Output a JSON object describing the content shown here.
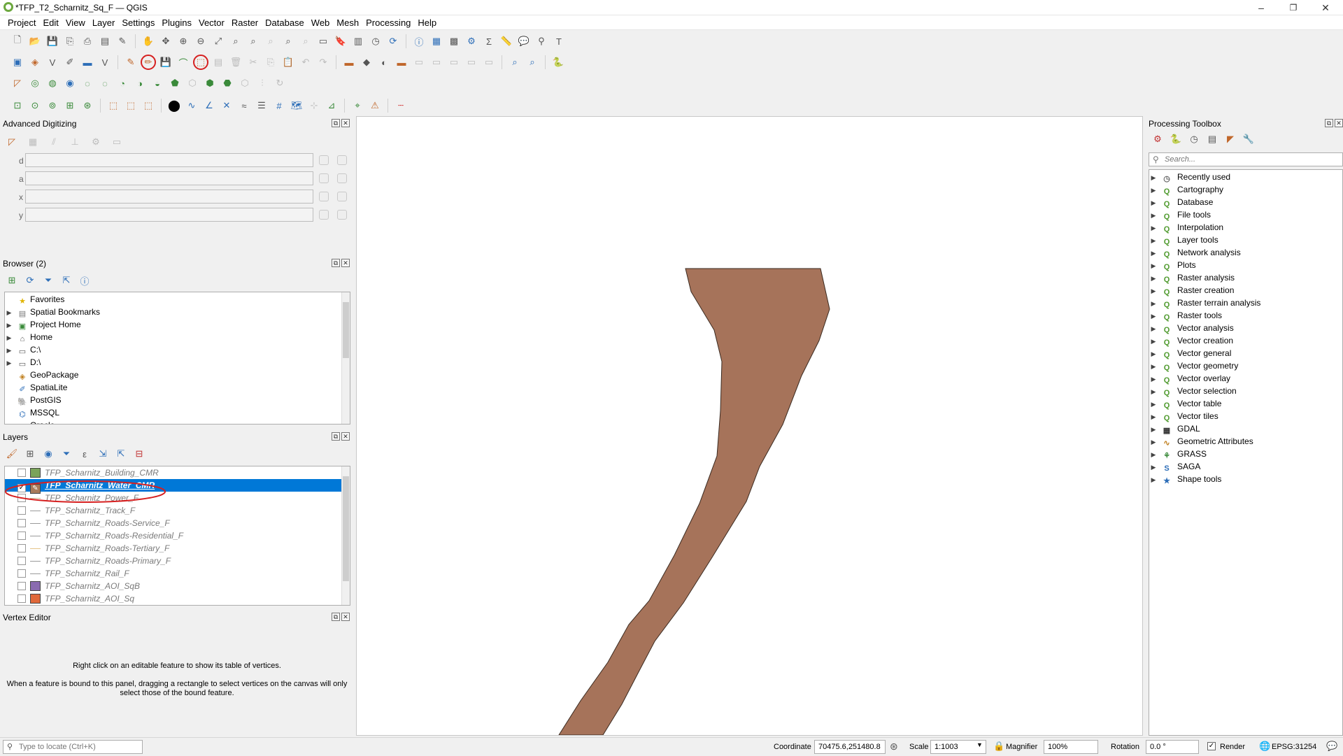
{
  "window": {
    "title": "*TFP_T2_Scharnitz_Sq_F — QGIS",
    "minimize": "–",
    "maximize": "❐",
    "close": "✕"
  },
  "menu": [
    "Project",
    "Edit",
    "View",
    "Layer",
    "Settings",
    "Plugins",
    "Vector",
    "Raster",
    "Database",
    "Web",
    "Mesh",
    "Processing",
    "Help"
  ],
  "advanced_digitizing": {
    "title": "Advanced Digitizing",
    "fields": [
      {
        "label": "d",
        "value": ""
      },
      {
        "label": "a",
        "value": ""
      },
      {
        "label": "x",
        "value": ""
      },
      {
        "label": "y",
        "value": ""
      }
    ]
  },
  "browser": {
    "title": "Browser (2)",
    "items": [
      {
        "label": "Favorites",
        "icon": "star-icon",
        "expandable": false
      },
      {
        "label": "Spatial Bookmarks",
        "icon": "bookmark-icon",
        "expandable": true
      },
      {
        "label": "Project Home",
        "icon": "project-home-icon",
        "expandable": true
      },
      {
        "label": "Home",
        "icon": "home-folder-icon",
        "expandable": true
      },
      {
        "label": "C:\\",
        "icon": "folder-icon",
        "expandable": true
      },
      {
        "label": "D:\\",
        "icon": "folder-icon",
        "expandable": true
      },
      {
        "label": "GeoPackage",
        "icon": "geopackage-icon",
        "expandable": false
      },
      {
        "label": "SpatiaLite",
        "icon": "spatialite-icon",
        "expandable": false
      },
      {
        "label": "PostGIS",
        "icon": "postgis-icon",
        "expandable": false
      },
      {
        "label": "MSSQL",
        "icon": "mssql-icon",
        "expandable": false
      },
      {
        "label": "Oracle",
        "icon": "oracle-icon",
        "expandable": false
      }
    ]
  },
  "layers": {
    "title": "Layers",
    "items": [
      {
        "name": "TFP_Scharnitz_Building_CMR",
        "checked": false,
        "selected": false,
        "symbol": "fill",
        "color": "#7aa35a"
      },
      {
        "name": "TFP_Scharnitz_Water_CMR",
        "checked": true,
        "selected": true,
        "symbol": "fill",
        "color": "#a87a5a"
      },
      {
        "name": "TFP_Scharnitz_Power_F",
        "checked": false,
        "selected": false,
        "symbol": "line",
        "color": "#c9b98f"
      },
      {
        "name": "TFP_Scharnitz_Track_F",
        "checked": false,
        "selected": false,
        "symbol": "line",
        "color": "#9a9a9a"
      },
      {
        "name": "TFP_Scharnitz_Roads-Service_F",
        "checked": false,
        "selected": false,
        "symbol": "line",
        "color": "#9a9a9a"
      },
      {
        "name": "TFP_Scharnitz_Roads-Residential_F",
        "checked": false,
        "selected": false,
        "symbol": "line",
        "color": "#9a9a9a"
      },
      {
        "name": "TFP_Scharnitz_Roads-Tertiary_F",
        "checked": false,
        "selected": false,
        "symbol": "line",
        "color": "#e6c58a"
      },
      {
        "name": "TFP_Scharnitz_Roads-Primary_F",
        "checked": false,
        "selected": false,
        "symbol": "line",
        "color": "#9a9a9a"
      },
      {
        "name": "TFP_Scharnitz_Rail_F",
        "checked": false,
        "selected": false,
        "symbol": "line",
        "color": "#9a9a9a"
      },
      {
        "name": "TFP_Scharnitz_AOI_SqB",
        "checked": false,
        "selected": false,
        "symbol": "fill",
        "color": "#8a6bb0"
      },
      {
        "name": "TFP_Scharnitz_AOI_Sq",
        "checked": false,
        "selected": false,
        "symbol": "fill",
        "color": "#e0683a"
      }
    ]
  },
  "vertex_editor": {
    "title": "Vertex Editor",
    "hint1": "Right click on an editable feature to show its table of vertices.",
    "hint2": "When a feature is bound to this panel, dragging a rectangle to select vertices on the canvas will only select those of the bound feature."
  },
  "processing": {
    "title": "Processing Toolbox",
    "search_placeholder": "Search...",
    "items": [
      {
        "label": "Recently used",
        "icon": "clock-icon"
      },
      {
        "label": "Cartography",
        "icon": "qgis-icon"
      },
      {
        "label": "Database",
        "icon": "qgis-icon"
      },
      {
        "label": "File tools",
        "icon": "qgis-icon"
      },
      {
        "label": "Interpolation",
        "icon": "qgis-icon"
      },
      {
        "label": "Layer tools",
        "icon": "qgis-icon"
      },
      {
        "label": "Network analysis",
        "icon": "qgis-icon"
      },
      {
        "label": "Plots",
        "icon": "qgis-icon"
      },
      {
        "label": "Raster analysis",
        "icon": "qgis-icon"
      },
      {
        "label": "Raster creation",
        "icon": "qgis-icon"
      },
      {
        "label": "Raster terrain analysis",
        "icon": "qgis-icon"
      },
      {
        "label": "Raster tools",
        "icon": "qgis-icon"
      },
      {
        "label": "Vector analysis",
        "icon": "qgis-icon"
      },
      {
        "label": "Vector creation",
        "icon": "qgis-icon"
      },
      {
        "label": "Vector general",
        "icon": "qgis-icon"
      },
      {
        "label": "Vector geometry",
        "icon": "qgis-icon"
      },
      {
        "label": "Vector overlay",
        "icon": "qgis-icon"
      },
      {
        "label": "Vector selection",
        "icon": "qgis-icon"
      },
      {
        "label": "Vector table",
        "icon": "qgis-icon"
      },
      {
        "label": "Vector tiles",
        "icon": "qgis-icon"
      },
      {
        "label": "GDAL",
        "icon": "gdal-icon"
      },
      {
        "label": "Geometric Attributes",
        "icon": "geometric-attributes-icon"
      },
      {
        "label": "GRASS",
        "icon": "grass-icon"
      },
      {
        "label": "SAGA",
        "icon": "saga-icon"
      },
      {
        "label": "Shape tools",
        "icon": "shape-tools-icon"
      }
    ]
  },
  "map": {
    "feature_color": "#a6735a",
    "feature_stroke": "#3a2a20"
  },
  "status": {
    "locator_placeholder": "Type to locate (Ctrl+K)",
    "coordinate_label": "Coordinate",
    "coordinate_value": "70475.6,251480.8",
    "scale_label": "Scale",
    "scale_value": "1:1003",
    "magnifier_label": "Magnifier",
    "magnifier_value": "100%",
    "rotation_label": "Rotation",
    "rotation_value": "0.0 °",
    "render_label": "Render",
    "render_checked": true,
    "crs": "EPSG:31254"
  }
}
